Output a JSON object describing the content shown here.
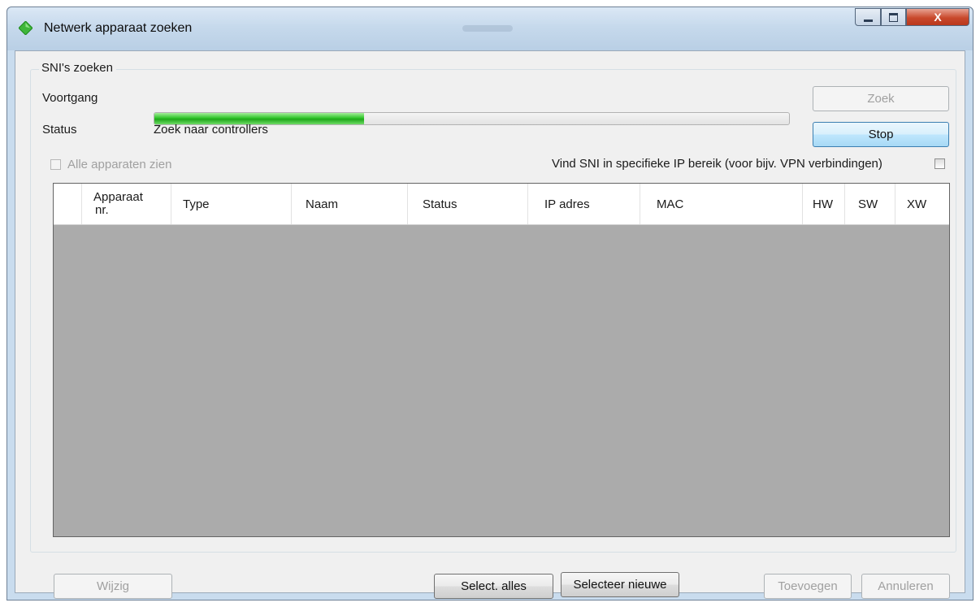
{
  "window": {
    "title": "Netwerk apparaat zoeken",
    "title_icon": "green-diamond-icon",
    "controls": {
      "minimize": "minimize-icon",
      "maximize": "maximize-icon",
      "close": "X"
    }
  },
  "group": {
    "title": "SNI's zoeken",
    "progress_label": "Voortgang",
    "progress_fraction": 0.33,
    "status_label": "Status",
    "status_value": "Zoek naar controllers",
    "search_button": "Zoek",
    "stop_button": "Stop",
    "show_all_devices": "Alle apparaten zien",
    "ip_range_label": "Vind SNI in specifieke IP bereik (voor bijv. VPN verbindingen)",
    "table": {
      "columns": [
        {
          "line1": "Apparaat",
          "line2": "nr."
        },
        {
          "label": "Type"
        },
        {
          "label": "Naam"
        },
        {
          "label": "Status"
        },
        {
          "label": "IP adres"
        },
        {
          "label": "MAC"
        },
        {
          "label": "HW"
        },
        {
          "label": "SW"
        },
        {
          "label": "XW"
        }
      ],
      "rows": []
    }
  },
  "footer": {
    "edit_button": "Wijzig",
    "select_all_button": "Select. alles",
    "select_new_button": "Selecteer nieuwe",
    "add_button": "Toevoegen",
    "cancel_button": "Annuleren"
  },
  "colors": {
    "titlebar": "#c6d9ec",
    "progress_green": "#2fc42a",
    "grid_background": "#ababab",
    "close_button": "#c9492c"
  }
}
